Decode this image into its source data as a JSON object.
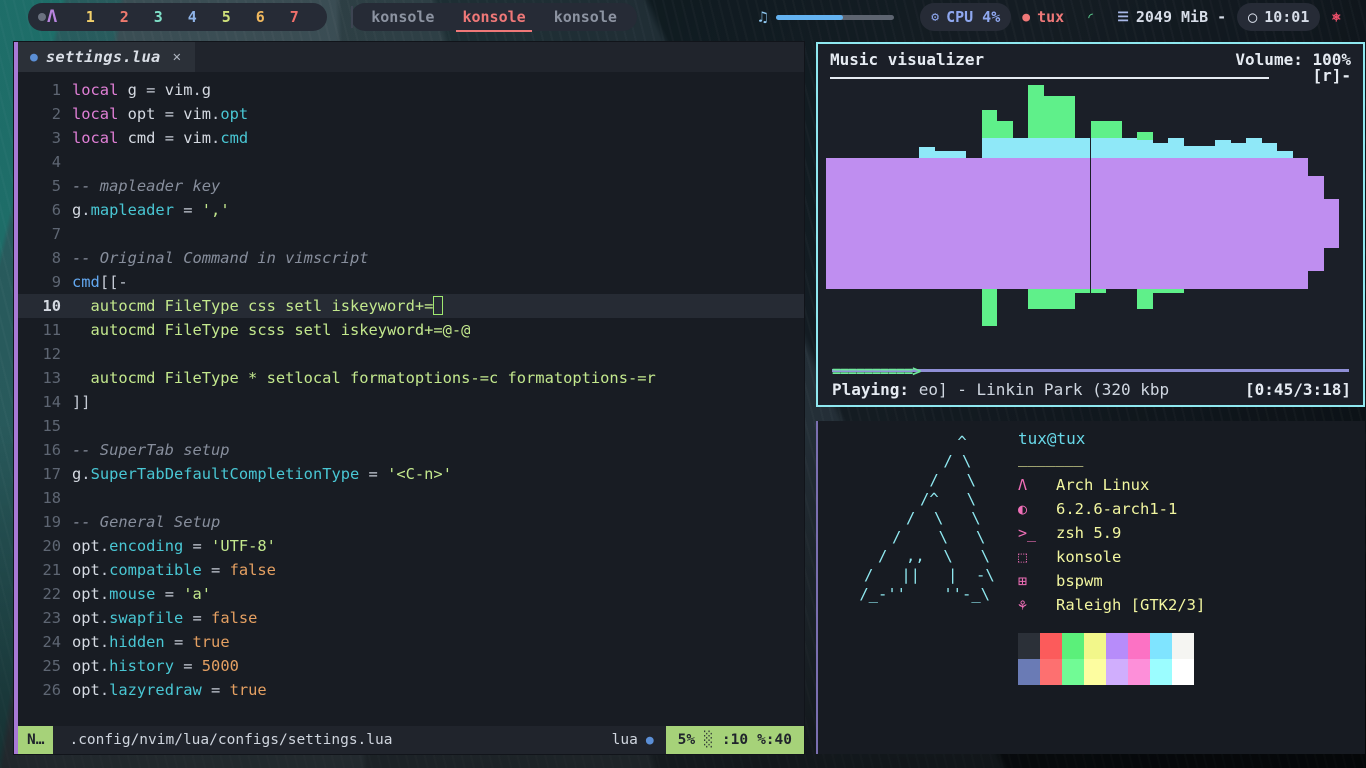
{
  "bar": {
    "distro_icon": "arch-icon",
    "tags": [
      {
        "label": "1",
        "color": "#f2d06b"
      },
      {
        "label": "2",
        "color": "#ef7a6e"
      },
      {
        "label": "3",
        "color": "#7fe0c8"
      },
      {
        "label": "4",
        "color": "#8fb4e8"
      },
      {
        "label": "5",
        "color": "#cfe07a"
      },
      {
        "label": "6",
        "color": "#f0b85e"
      },
      {
        "label": "7",
        "color": "#f0706b"
      }
    ],
    "tabs": [
      {
        "label": "konsole",
        "active": false
      },
      {
        "label": "konsole",
        "active": true
      },
      {
        "label": "konsole",
        "active": false
      }
    ],
    "volume_icon": "music-note-icon",
    "volume_percent": 57,
    "cpu_icon": "cpu-icon",
    "cpu_label": "CPU 4%",
    "user_icon": "user-icon",
    "user_label": "tux",
    "wifi_icon": "wifi-icon",
    "memory_icon": "chart-bars-icon",
    "memory_label": "2049 MiB -",
    "clock_icon": "clock-icon",
    "clock_label": "10:01",
    "power_icon": "power-icon",
    "accent": "#ef7878"
  },
  "editor": {
    "tab": {
      "filename": "settings.lua",
      "lang_icon": "lua-icon",
      "close_icon": "close-icon"
    },
    "cursor_line": 10,
    "lines": [
      {
        "n": "1",
        "tokens": [
          {
            "t": "local",
            "c": "kw"
          },
          {
            "t": " g ",
            "c": "id"
          },
          {
            "t": "= ",
            "c": "op"
          },
          {
            "t": "vim",
            "c": "id"
          },
          {
            "t": ".",
            "c": "pun"
          },
          {
            "t": "g",
            "c": "id"
          }
        ]
      },
      {
        "n": "2",
        "tokens": [
          {
            "t": "local",
            "c": "kw"
          },
          {
            "t": " opt ",
            "c": "id"
          },
          {
            "t": "= ",
            "c": "op"
          },
          {
            "t": "vim",
            "c": "id"
          },
          {
            "t": ".",
            "c": "pun"
          },
          {
            "t": "opt",
            "c": "fld"
          }
        ]
      },
      {
        "n": "3",
        "tokens": [
          {
            "t": "local",
            "c": "kw"
          },
          {
            "t": " cmd ",
            "c": "id"
          },
          {
            "t": "= ",
            "c": "op"
          },
          {
            "t": "vim",
            "c": "id"
          },
          {
            "t": ".",
            "c": "pun"
          },
          {
            "t": "cmd",
            "c": "fld"
          }
        ]
      },
      {
        "n": "4",
        "tokens": []
      },
      {
        "n": "5",
        "tokens": [
          {
            "t": "-- mapleader key",
            "c": "cm"
          }
        ]
      },
      {
        "n": "6",
        "tokens": [
          {
            "t": "g",
            "c": "id"
          },
          {
            "t": ".",
            "c": "pun"
          },
          {
            "t": "mapleader",
            "c": "fld"
          },
          {
            "t": " = ",
            "c": "op"
          },
          {
            "t": "','",
            "c": "str"
          }
        ]
      },
      {
        "n": "7",
        "tokens": []
      },
      {
        "n": "8",
        "tokens": [
          {
            "t": "-- Original Command in vimscript",
            "c": "cm"
          }
        ]
      },
      {
        "n": "9",
        "tokens": [
          {
            "t": "cmd",
            "c": "fn"
          },
          {
            "t": "[[-",
            "c": "pun"
          }
        ]
      },
      {
        "n": "10",
        "tokens": [
          {
            "t": "  autocmd FileType css setl iskeyword+=",
            "c": "str"
          }
        ],
        "cursor": true
      },
      {
        "n": "11",
        "tokens": [
          {
            "t": "  autocmd FileType scss setl iskeyword+=@-@",
            "c": "str"
          }
        ]
      },
      {
        "n": "12",
        "tokens": []
      },
      {
        "n": "13",
        "tokens": [
          {
            "t": "  autocmd FileType * setlocal formatoptions-=c formatoptions-=r",
            "c": "str"
          }
        ]
      },
      {
        "n": "14",
        "tokens": [
          {
            "t": "]]",
            "c": "pun"
          }
        ]
      },
      {
        "n": "15",
        "tokens": []
      },
      {
        "n": "16",
        "tokens": [
          {
            "t": "-- SuperTab setup",
            "c": "cm"
          }
        ]
      },
      {
        "n": "17",
        "tokens": [
          {
            "t": "g",
            "c": "id"
          },
          {
            "t": ".",
            "c": "pun"
          },
          {
            "t": "SuperTabDefaultCompletionType",
            "c": "fld"
          },
          {
            "t": " = ",
            "c": "op"
          },
          {
            "t": "'<C-n>'",
            "c": "str"
          }
        ]
      },
      {
        "n": "18",
        "tokens": []
      },
      {
        "n": "19",
        "tokens": [
          {
            "t": "-- General Setup",
            "c": "cm"
          }
        ]
      },
      {
        "n": "20",
        "tokens": [
          {
            "t": "opt",
            "c": "id"
          },
          {
            "t": ".",
            "c": "pun"
          },
          {
            "t": "encoding",
            "c": "fld"
          },
          {
            "t": " = ",
            "c": "op"
          },
          {
            "t": "'UTF-8'",
            "c": "str"
          }
        ]
      },
      {
        "n": "21",
        "tokens": [
          {
            "t": "opt",
            "c": "id"
          },
          {
            "t": ".",
            "c": "pun"
          },
          {
            "t": "compatible",
            "c": "fld"
          },
          {
            "t": " = ",
            "c": "op"
          },
          {
            "t": "false",
            "c": "bool"
          }
        ]
      },
      {
        "n": "22",
        "tokens": [
          {
            "t": "opt",
            "c": "id"
          },
          {
            "t": ".",
            "c": "pun"
          },
          {
            "t": "mouse",
            "c": "fld"
          },
          {
            "t": " = ",
            "c": "op"
          },
          {
            "t": "'a'",
            "c": "str"
          }
        ]
      },
      {
        "n": "23",
        "tokens": [
          {
            "t": "opt",
            "c": "id"
          },
          {
            "t": ".",
            "c": "pun"
          },
          {
            "t": "swapfile",
            "c": "fld"
          },
          {
            "t": " = ",
            "c": "op"
          },
          {
            "t": "false",
            "c": "bool"
          }
        ]
      },
      {
        "n": "24",
        "tokens": [
          {
            "t": "opt",
            "c": "id"
          },
          {
            "t": ".",
            "c": "pun"
          },
          {
            "t": "hidden",
            "c": "fld"
          },
          {
            "t": " = ",
            "c": "op"
          },
          {
            "t": "true",
            "c": "bool"
          }
        ]
      },
      {
        "n": "25",
        "tokens": [
          {
            "t": "opt",
            "c": "id"
          },
          {
            "t": ".",
            "c": "pun"
          },
          {
            "t": "history",
            "c": "fld"
          },
          {
            "t": " = ",
            "c": "op"
          },
          {
            "t": "5000",
            "c": "num2"
          }
        ]
      },
      {
        "n": "26",
        "tokens": [
          {
            "t": "opt",
            "c": "id"
          },
          {
            "t": ".",
            "c": "pun"
          },
          {
            "t": "lazyredraw",
            "c": "fld"
          },
          {
            "t": " = ",
            "c": "op"
          },
          {
            "t": "true",
            "c": "bool"
          }
        ]
      }
    ],
    "status": {
      "mode": "N…",
      "path": ".config/nvim/lua/configs/settings.lua",
      "filetype": "lua",
      "filetype_icon": "lua-icon",
      "percent": "5%",
      "scroll_icon": "░",
      "line": ":10",
      "column": "%:40"
    }
  },
  "visualizer": {
    "title": "Music visualizer",
    "volume": "Volume: 100%",
    "mode_tag": "[r]-",
    "playing_label": "Playing:",
    "track": "eo] - Linkin Park (320 kbp",
    "time": "[0:45/3:18]",
    "progress_percent": 23,
    "progress_glyphs": "==========>",
    "colors": {
      "border": "#8fe8f0",
      "center": "#bf8ef0",
      "mid": "#8fe8f8",
      "peak": "#5ff08a"
    },
    "bars": [
      {
        "mid": 0.3,
        "peak": 0.0
      },
      {
        "mid": 0.42,
        "peak": 0.0
      },
      {
        "mid": 0.3,
        "peak": 0.0
      },
      {
        "mid": 0.44,
        "peak": 0.0
      },
      {
        "mid": 0.3,
        "peak": 0.0
      },
      {
        "mid": 0.38,
        "peak": 0.0
      },
      {
        "mid": 0.55,
        "peak": 0.0
      },
      {
        "mid": 0.52,
        "peak": 0.0
      },
      {
        "mid": 0.52,
        "peak": 0.0
      },
      {
        "mid": 0.38,
        "peak": 0.0
      },
      {
        "mid": 0.62,
        "peak": 0.82
      },
      {
        "mid": 0.62,
        "peak": 0.74
      },
      {
        "mid": 0.62,
        "peak": 0.62
      },
      {
        "mid": 0.62,
        "peak": 1.0
      },
      {
        "mid": 0.62,
        "peak": 0.92
      },
      {
        "mid": 0.62,
        "peak": 0.92
      },
      {
        "mid": 0.62,
        "peak": 0.62
      },
      {
        "mid": 0.62,
        "peak": 0.74
      },
      {
        "mid": 0.62,
        "peak": 0.74
      },
      {
        "mid": 0.62,
        "peak": 0.62
      },
      {
        "mid": 0.6,
        "peak": 0.66
      },
      {
        "mid": 0.58,
        "peak": 0.0
      },
      {
        "mid": 0.62,
        "peak": 0.0
      },
      {
        "mid": 0.56,
        "peak": 0.0
      },
      {
        "mid": 0.56,
        "peak": 0.0
      },
      {
        "mid": 0.6,
        "peak": 0.0
      },
      {
        "mid": 0.58,
        "peak": 0.0
      },
      {
        "mid": 0.62,
        "peak": 0.0
      },
      {
        "mid": 0.58,
        "peak": 0.0
      },
      {
        "mid": 0.52,
        "peak": 0.0
      },
      {
        "mid": 0.44,
        "peak": 0.0
      },
      {
        "mid": 0.3,
        "peak": 0.0
      },
      {
        "mid": 0.12,
        "peak": 0.0
      },
      {
        "mid": 0.0,
        "peak": 0.0
      }
    ],
    "bars_lower": [
      {
        "mid": 0.34,
        "peak": 0.0
      },
      {
        "mid": 0.34,
        "peak": 0.0
      },
      {
        "mid": 0.34,
        "peak": 0.0
      },
      {
        "mid": 0.34,
        "peak": 0.0
      },
      {
        "mid": 0.28,
        "peak": 0.0
      },
      {
        "mid": 0.44,
        "peak": 0.0
      },
      {
        "mid": 0.44,
        "peak": 0.0
      },
      {
        "mid": 0.38,
        "peak": 0.0
      },
      {
        "mid": 0.3,
        "peak": 0.0
      },
      {
        "mid": 0.3,
        "peak": 0.0
      },
      {
        "mid": 0.46,
        "peak": 0.74
      },
      {
        "mid": 0.46,
        "peak": 0.44
      },
      {
        "mid": 0.46,
        "peak": 0.28
      },
      {
        "mid": 0.46,
        "peak": 0.62
      },
      {
        "mid": 0.46,
        "peak": 0.62
      },
      {
        "mid": 0.46,
        "peak": 0.62
      },
      {
        "mid": 0.46,
        "peak": 0.5
      },
      {
        "mid": 0.46,
        "peak": 0.5
      },
      {
        "mid": 0.46,
        "peak": 0.38
      },
      {
        "mid": 0.46,
        "peak": 0.44
      },
      {
        "mid": 0.46,
        "peak": 0.62
      },
      {
        "mid": 0.46,
        "peak": 0.5
      },
      {
        "mid": 0.46,
        "peak": 0.5
      },
      {
        "mid": 0.46,
        "peak": 0.28
      },
      {
        "mid": 0.46,
        "peak": 0.44
      },
      {
        "mid": 0.4,
        "peak": 0.28
      },
      {
        "mid": 0.4,
        "peak": 0.44
      },
      {
        "mid": 0.34,
        "peak": 0.28
      },
      {
        "mid": 0.3,
        "peak": 0.0
      },
      {
        "mid": 0.28,
        "peak": 0.0
      },
      {
        "mid": 0.22,
        "peak": 0.0
      },
      {
        "mid": 0.14,
        "peak": 0.0
      },
      {
        "mid": 0.06,
        "peak": 0.0
      },
      {
        "mid": 0.0,
        "peak": 0.0
      }
    ]
  },
  "fetch": {
    "ascii": "         ^\n        / \\\n       /   \\\n      /^   \\\n     /  \\   \\\n    /    \\   \\\n   /  ,,  \\   \\\n  /   ||   |  -\\\n /_-''    ''-_\\",
    "user": "tux@tux",
    "rule": "_______",
    "rows": [
      {
        "icon": "arch-icon",
        "glyph": "Λ",
        "value": "Arch Linux"
      },
      {
        "icon": "linux-tux-icon",
        "glyph": "◐",
        "value": "6.2.6-arch1-1"
      },
      {
        "icon": "shell-prompt-icon",
        "glyph": ">_",
        "value": "zsh 5.9"
      },
      {
        "icon": "terminal-icon",
        "glyph": "⬚",
        "value": "konsole"
      },
      {
        "icon": "grid-wm-icon",
        "glyph": "⊞",
        "value": "bspwm"
      },
      {
        "icon": "theme-palm-icon",
        "glyph": "⚘",
        "value": "Raleigh [GTK2/3]"
      }
    ],
    "palette_top": [
      "#2b3038",
      "#fc5b5b",
      "#5bf07a",
      "#f2f78a",
      "#b78cfa",
      "#fc72c4",
      "#7fe4ff",
      "#f5f5f2"
    ],
    "palette_bottom": [
      "#6a7bb5",
      "#fd7070",
      "#71fb95",
      "#fdfda0",
      "#d0aefd",
      "#fd8fd9",
      "#9bfdff",
      "#ffffff"
    ]
  }
}
